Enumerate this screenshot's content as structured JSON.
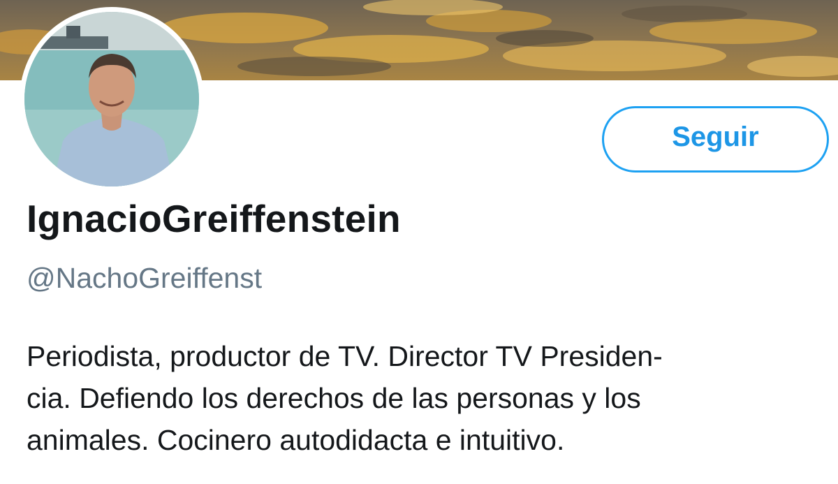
{
  "profile": {
    "display_name": "IgnacioGreiffenstein",
    "handle": "@NachoGreiffenst",
    "bio_lines": [
      "Periodista, productor de TV. Director TV Presiden-",
      "cia. Defiendo los derechos de las personas y los",
      "animales. Cocinero autodidacta e intuitivo."
    ]
  },
  "actions": {
    "follow_label": "Seguir"
  },
  "colors": {
    "accent": "#1da1f2",
    "name_text": "#14171a",
    "handle_text": "#657786"
  }
}
